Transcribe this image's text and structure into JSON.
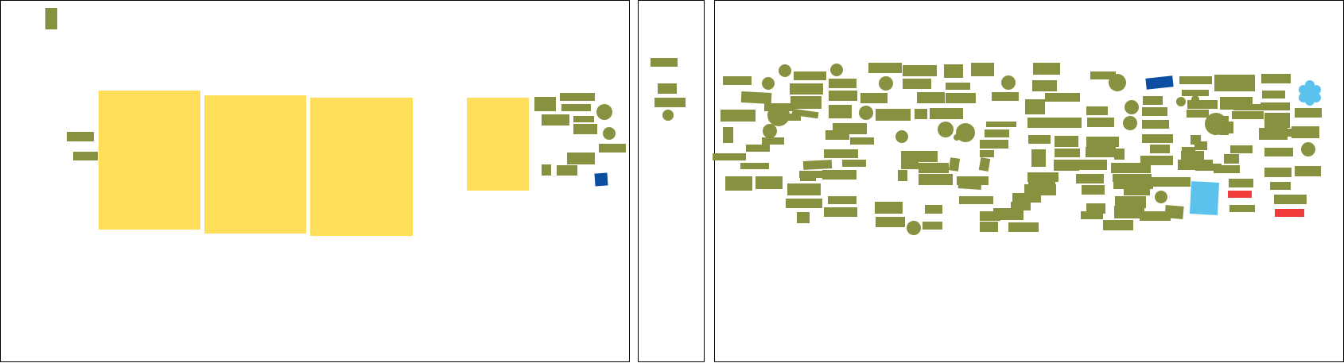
{
  "colors": {
    "olive": "#88913f",
    "yellow": "#ffde59",
    "dark_blue": "#0b4ea2",
    "light_blue": "#5bc2ed",
    "red": "#f23b3b",
    "border": "#000000",
    "background": "#ffffff"
  },
  "panels": [
    {
      "name": "panel-left"
    },
    {
      "name": "panel-middle"
    },
    {
      "name": "panel-right"
    }
  ],
  "legend": [],
  "labels": []
}
